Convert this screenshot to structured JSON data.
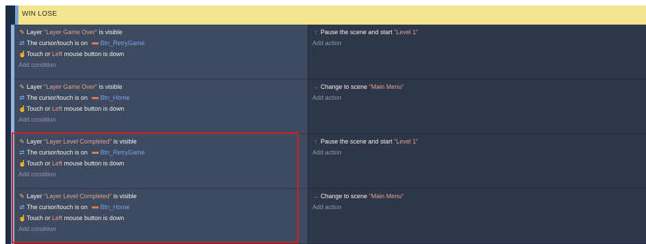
{
  "group": {
    "title": "WIN LOSE"
  },
  "common": {
    "add_condition": "Add condition",
    "add_action": "Add action"
  },
  "events": [
    {
      "conditions": [
        {
          "icon": "pencil-icon",
          "prefix": "Layer ",
          "str": "\"Layer Game Over\"",
          "suffix": " is visible"
        },
        {
          "icon": "cursor-icon",
          "prefix": "The cursor/touch is on ",
          "obj": "Btn_RetryGame"
        },
        {
          "icon": "touch-icon",
          "prefix": "Touch or ",
          "key": "Left",
          "suffix": " mouse button is down"
        }
      ],
      "action": {
        "icon": "arrow-up-icon",
        "prefix": "Pause the scene and start ",
        "str": "\"Level 1\""
      }
    },
    {
      "conditions": [
        {
          "icon": "pencil-icon",
          "prefix": "Layer ",
          "str": "\"Layer Game Over\"",
          "suffix": " is visible"
        },
        {
          "icon": "cursor-icon",
          "prefix": "The cursor/touch is on ",
          "obj": "Btn_Home"
        },
        {
          "icon": "touch-icon",
          "prefix": "Touch or ",
          "key": "Left",
          "suffix": " mouse button is down"
        }
      ],
      "action": {
        "icon": "arrow-right-icon",
        "prefix": "Change to scene ",
        "str": "\"Main Menu\""
      }
    },
    {
      "conditions": [
        {
          "icon": "pencil-icon",
          "prefix": "Layer ",
          "str": "\"Layer Level Completed\"",
          "suffix": " is visible"
        },
        {
          "icon": "cursor-icon",
          "prefix": "The cursor/touch is on ",
          "obj": "Btn_RetryGame"
        },
        {
          "icon": "touch-icon",
          "prefix": "Touch or ",
          "key": "Left",
          "suffix": " mouse button is down"
        }
      ],
      "action": {
        "icon": "arrow-up-icon",
        "prefix": "Pause the scene and start ",
        "str": "\"Level 1\""
      }
    },
    {
      "conditions": [
        {
          "icon": "pencil-icon",
          "prefix": "Layer ",
          "str": "\"Layer Level Completed\"",
          "suffix": " is visible"
        },
        {
          "icon": "cursor-icon",
          "prefix": "The cursor/touch is on ",
          "obj": "Btn_Home"
        },
        {
          "icon": "touch-icon",
          "prefix": "Touch or ",
          "key": "Left",
          "suffix": " mouse button is down"
        }
      ],
      "action": {
        "icon": "arrow-right-icon",
        "prefix": "Change to scene ",
        "str": "\"Main Menu\""
      }
    }
  ],
  "colors": {
    "header_bg": "#f3e48f",
    "condition_bg": "#3e4a60",
    "action_bg": "#2e3749",
    "string_color": "#e0a08d",
    "object_color": "#78a5ea",
    "highlight_border": "#d61e1e"
  }
}
